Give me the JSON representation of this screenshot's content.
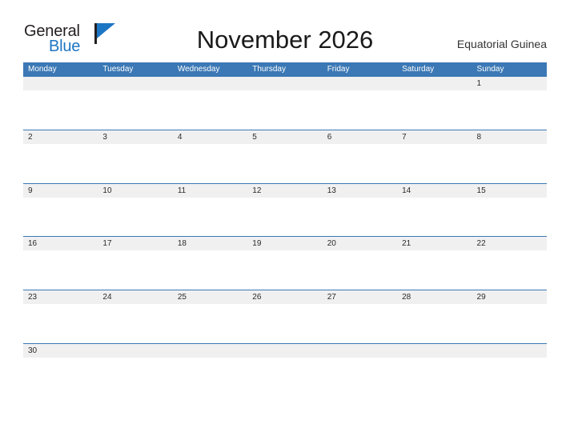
{
  "logo": {
    "word_primary": "General",
    "word_secondary": "Blue",
    "primary_color": "#231f20",
    "secondary_color": "#1d76c4",
    "flag_icon": "flag-triangle-icon"
  },
  "header": {
    "title": "November 2026",
    "locale_label": "Equatorial Guinea"
  },
  "theme": {
    "header_blue": "#3b78b5",
    "band_gray": "#f0f0f0",
    "rule_blue": "#3b78b5",
    "text_dark": "#2a2a2a",
    "header_text": "#ffffff"
  },
  "calendar": {
    "month": "November",
    "year": "2026",
    "first_day_of_week": "Monday",
    "weekdays": [
      "Monday",
      "Tuesday",
      "Wednesday",
      "Thursday",
      "Friday",
      "Saturday",
      "Sunday"
    ],
    "weeks": [
      {
        "days": [
          "",
          "",
          "",
          "",
          "",
          "",
          "1"
        ]
      },
      {
        "days": [
          "2",
          "3",
          "4",
          "5",
          "6",
          "7",
          "8"
        ]
      },
      {
        "days": [
          "9",
          "10",
          "11",
          "12",
          "13",
          "14",
          "15"
        ]
      },
      {
        "days": [
          "16",
          "17",
          "18",
          "19",
          "20",
          "21",
          "22"
        ]
      },
      {
        "days": [
          "23",
          "24",
          "25",
          "26",
          "27",
          "28",
          "29"
        ]
      },
      {
        "days": [
          "30",
          "",
          "",
          "",
          "",
          "",
          ""
        ]
      }
    ]
  }
}
